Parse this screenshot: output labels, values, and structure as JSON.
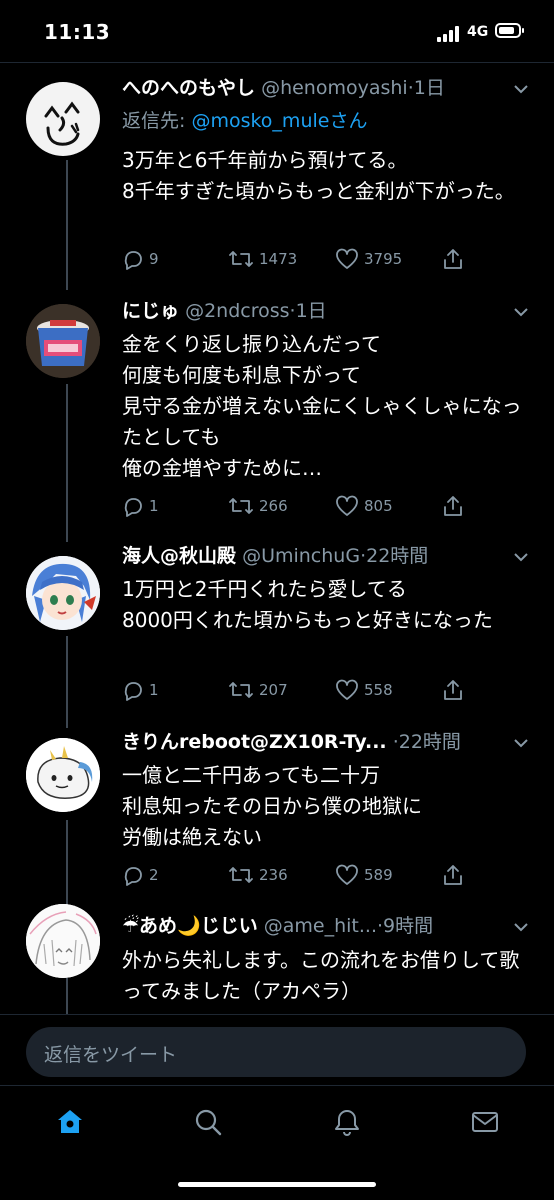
{
  "status_bar": {
    "time": "11:13",
    "network": "4G",
    "battery_level": 0.85
  },
  "tweets": [
    {
      "display_name": "へのへのもやし",
      "handle": "@henomoyashi",
      "time": "·1日",
      "reply_prefix": "返信先: ",
      "reply_mention": "@mosko_mule",
      "reply_suffix": "さん",
      "text": "3万年と6千年前から預けてる。\n8千年すぎた頃からもっと金利が下がった。",
      "replies": "9",
      "retweets": "1473",
      "likes": "3795"
    },
    {
      "display_name": "にじゅ",
      "handle": "@2ndcross",
      "time": "·1日",
      "text": "金をくり返し振り込んだって\n何度も何度も利息下がって\n見守る金が増えない金にくしゃくしゃになったとしても\n俺の金増やすために…",
      "replies": "1",
      "retweets": "266",
      "likes": "805"
    },
    {
      "display_name": "海人@秋山殿",
      "handle": "@UminchuG",
      "time": "·22時間",
      "text": "1万円と2千円くれたら愛してる\n8000円くれた頃からもっと好きになった",
      "replies": "1",
      "retweets": "207",
      "likes": "558"
    },
    {
      "display_name": "きりんreboot@ZX10R-Ty...",
      "handle": "",
      "time": "·22時間",
      "text": "一億と二千円あっても二十万\n利息知ったその日から僕の地獄に\n労働は絶えない",
      "replies": "2",
      "retweets": "236",
      "likes": "589"
    },
    {
      "display_name": "☔あめ🌙じじい",
      "handle": "@ame_hit...",
      "time": "·9時間",
      "text": "外から失礼します。この流れをお借りして歌ってみました（アカペラ）"
    }
  ],
  "reply_placeholder": "返信をツイート",
  "tabs": [
    "home-icon",
    "search-icon",
    "notifications-icon",
    "messages-icon"
  ],
  "colors": {
    "accent": "#1da1f2",
    "muted": "#8899a6",
    "background": "#000000"
  }
}
